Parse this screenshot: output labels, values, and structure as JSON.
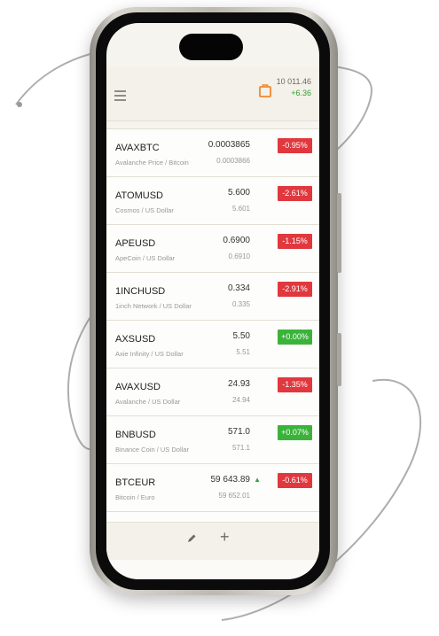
{
  "header": {
    "balance": "10 011.46",
    "change": "+6.36",
    "menu_icon": "hamburger-menu-icon",
    "portfolio_icon": "briefcase-icon"
  },
  "colors": {
    "positive": "#3bb33b",
    "negative": "#e0383e",
    "accent": "#f0892c"
  },
  "instruments": [
    {
      "symbol": "AVAXBTC",
      "description": "Avalanche Price / Bitcoin",
      "price": "0.0003865",
      "previous": "0.0003866",
      "change": "-0.95%",
      "direction": "down",
      "arrow": ""
    },
    {
      "symbol": "ATOMUSD",
      "description": "Cosmos / US Dollar",
      "price": "5.600",
      "previous": "5.601",
      "change": "-2.61%",
      "direction": "down",
      "arrow": ""
    },
    {
      "symbol": "APEUSD",
      "description": "ApeCoin / US Dollar",
      "price": "0.6900",
      "previous": "0.6910",
      "change": "-1.15%",
      "direction": "down",
      "arrow": ""
    },
    {
      "symbol": "1INCHUSD",
      "description": "1inch Network / US Dollar",
      "price": "0.334",
      "previous": "0.335",
      "change": "-2.91%",
      "direction": "down",
      "arrow": ""
    },
    {
      "symbol": "AXSUSD",
      "description": "Axie Infinity / US Dollar",
      "price": "5.50",
      "previous": "5.51",
      "change": "+0.00%",
      "direction": "up",
      "arrow": ""
    },
    {
      "symbol": "AVAXUSD",
      "description": "Avalanche / US Dollar",
      "price": "24.93",
      "previous": "24.94",
      "change": "-1.35%",
      "direction": "down",
      "arrow": ""
    },
    {
      "symbol": "BNBUSD",
      "description": "Binance Coin / US Dollar",
      "price": "571.0",
      "previous": "571.1",
      "change": "+0.07%",
      "direction": "up",
      "arrow": ""
    },
    {
      "symbol": "BTCEUR",
      "description": "Bitcoin / Euro",
      "price": "59 643.89",
      "previous": "59 652.01",
      "change": "-0.61%",
      "direction": "down",
      "arrow": "▲"
    }
  ],
  "toolbar": {
    "edit_icon": "pencil-icon",
    "add_label": "+"
  }
}
